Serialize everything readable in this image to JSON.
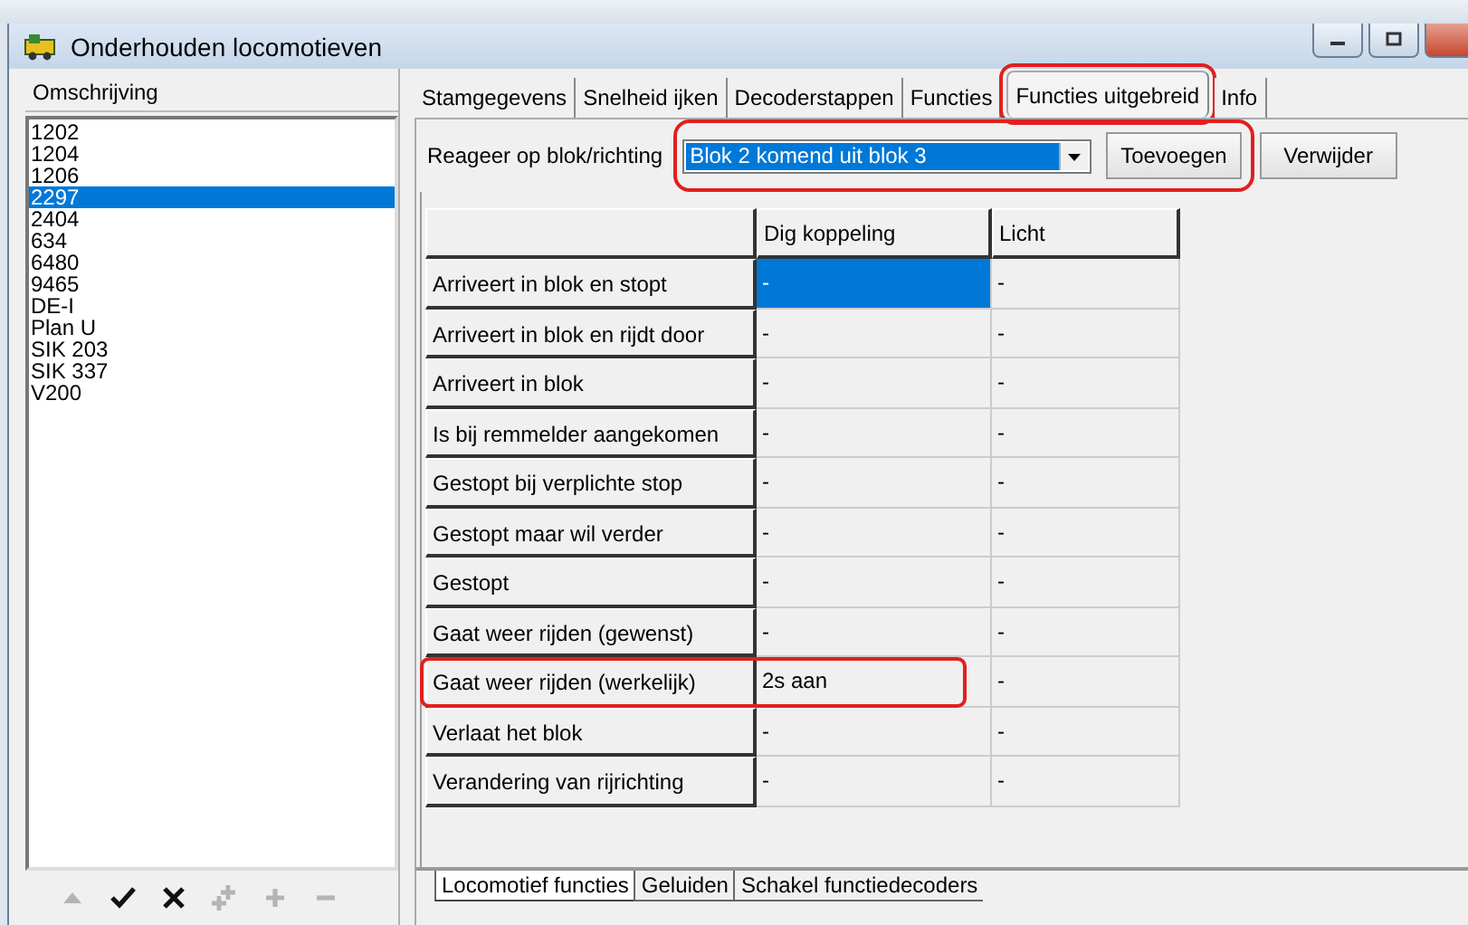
{
  "window": {
    "title": "Onderhouden locomotieven"
  },
  "list": {
    "header": "Omschrijving",
    "items": [
      {
        "label": "1202",
        "selected": false
      },
      {
        "label": "1204",
        "selected": false
      },
      {
        "label": "1206",
        "selected": false
      },
      {
        "label": "2297",
        "selected": true
      },
      {
        "label": "2404",
        "selected": false
      },
      {
        "label": "634",
        "selected": false
      },
      {
        "label": "6480",
        "selected": false
      },
      {
        "label": "9465",
        "selected": false
      },
      {
        "label": "DE-I",
        "selected": false
      },
      {
        "label": "Plan U",
        "selected": false
      },
      {
        "label": "SIK 203",
        "selected": false
      },
      {
        "label": "SIK 337",
        "selected": false
      },
      {
        "label": "V200",
        "selected": false
      }
    ]
  },
  "toolbar": [
    {
      "kind": "up",
      "disabled": true
    },
    {
      "kind": "check",
      "disabled": false
    },
    {
      "kind": "cross",
      "disabled": false
    },
    {
      "kind": "multi-add",
      "disabled": true
    },
    {
      "kind": "add",
      "disabled": true
    },
    {
      "kind": "remove",
      "disabled": true
    }
  ],
  "tabs": [
    {
      "label": "Stamgegevens",
      "selected": false
    },
    {
      "label": "Snelheid ijken",
      "selected": false
    },
    {
      "label": "Decoderstappen",
      "selected": false
    },
    {
      "label": "Functies",
      "selected": false
    },
    {
      "label": "Functies uitgebreid",
      "selected": true,
      "highlighted": true
    },
    {
      "label": "Info",
      "selected": false
    }
  ],
  "block_row": {
    "label": "Reageer op blok/richting",
    "value": "Blok 2 komend uit blok 3",
    "buttons": [
      "Toevoegen",
      "Verwijder"
    ],
    "highlighted": true
  },
  "table": {
    "columns": [
      "Dig koppeling",
      "Licht"
    ],
    "rows": [
      {
        "label": "Arriveert in blok en stopt",
        "cells": [
          {
            "text": "-",
            "selected": true
          },
          {
            "text": "-",
            "selected": false
          }
        ]
      },
      {
        "label": "Arriveert in blok en rijdt door",
        "cells": [
          {
            "text": "-",
            "selected": false
          },
          {
            "text": "-",
            "selected": false
          }
        ]
      },
      {
        "label": "Arriveert in blok",
        "cells": [
          {
            "text": "-",
            "selected": false
          },
          {
            "text": "-",
            "selected": false
          }
        ]
      },
      {
        "label": "Is bij remmelder aangekomen",
        "cells": [
          {
            "text": "-",
            "selected": false
          },
          {
            "text": "-",
            "selected": false
          }
        ]
      },
      {
        "label": "Gestopt bij verplichte stop",
        "cells": [
          {
            "text": "-",
            "selected": false
          },
          {
            "text": "-",
            "selected": false
          }
        ]
      },
      {
        "label": "Gestopt maar wil verder",
        "cells": [
          {
            "text": "-",
            "selected": false
          },
          {
            "text": "-",
            "selected": false
          }
        ]
      },
      {
        "label": "Gestopt",
        "cells": [
          {
            "text": "-",
            "selected": false
          },
          {
            "text": "-",
            "selected": false
          }
        ]
      },
      {
        "label": "Gaat weer rijden (gewenst)",
        "cells": [
          {
            "text": "-",
            "selected": false
          },
          {
            "text": "-",
            "selected": false
          }
        ]
      },
      {
        "label": "Gaat weer rijden (werkelijk)",
        "highlighted": true,
        "cells": [
          {
            "text": "2s aan",
            "selected": false
          },
          {
            "text": "-",
            "selected": false
          }
        ]
      },
      {
        "label": "Verlaat het blok",
        "cells": [
          {
            "text": "-",
            "selected": false
          },
          {
            "text": "-",
            "selected": false
          }
        ]
      },
      {
        "label": "Verandering van rijrichting",
        "cells": [
          {
            "text": "-",
            "selected": false
          },
          {
            "text": "-",
            "selected": false
          }
        ]
      }
    ]
  },
  "bottom_tabs": [
    {
      "label": "Locomotief functies",
      "selected": true
    },
    {
      "label": "Geluiden",
      "selected": false
    },
    {
      "label": "Schakel functiedecoders",
      "selected": false
    }
  ]
}
